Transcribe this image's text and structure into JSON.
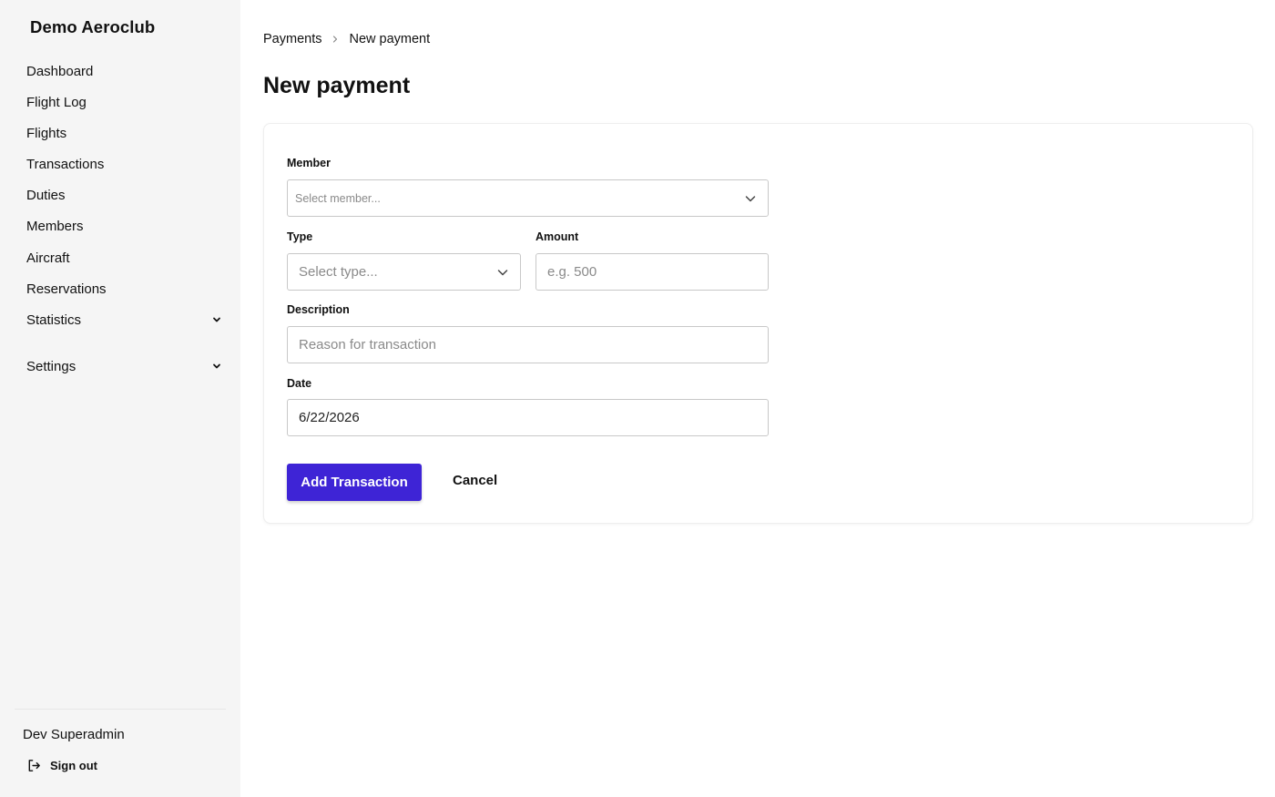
{
  "brand": "Demo Aeroclub",
  "sidebar": {
    "items": [
      {
        "label": "Dashboard"
      },
      {
        "label": "Flight Log"
      },
      {
        "label": "Flights"
      },
      {
        "label": "Transactions"
      },
      {
        "label": "Duties"
      },
      {
        "label": "Members"
      },
      {
        "label": "Aircraft"
      },
      {
        "label": "Reservations"
      },
      {
        "label": "Statistics",
        "expandable": true
      },
      {
        "label": "Settings",
        "expandable": true
      }
    ],
    "user_name": "Dev Superadmin",
    "sign_out": "Sign out"
  },
  "breadcrumb": {
    "parent": "Payments",
    "current": "New payment"
  },
  "page_title": "New payment",
  "form": {
    "member": {
      "label": "Member",
      "placeholder": "Select member..."
    },
    "type": {
      "label": "Type",
      "placeholder": "Select type..."
    },
    "amount": {
      "label": "Amount",
      "placeholder": "e.g. 500"
    },
    "description": {
      "label": "Description",
      "placeholder": "Reason for transaction"
    },
    "date": {
      "label": "Date",
      "value": "6/22/2026"
    },
    "submit_label": "Add Transaction",
    "cancel_label": "Cancel"
  },
  "colors": {
    "accent": "#3e24d6",
    "sidebar_bg": "#f5f5f5"
  }
}
